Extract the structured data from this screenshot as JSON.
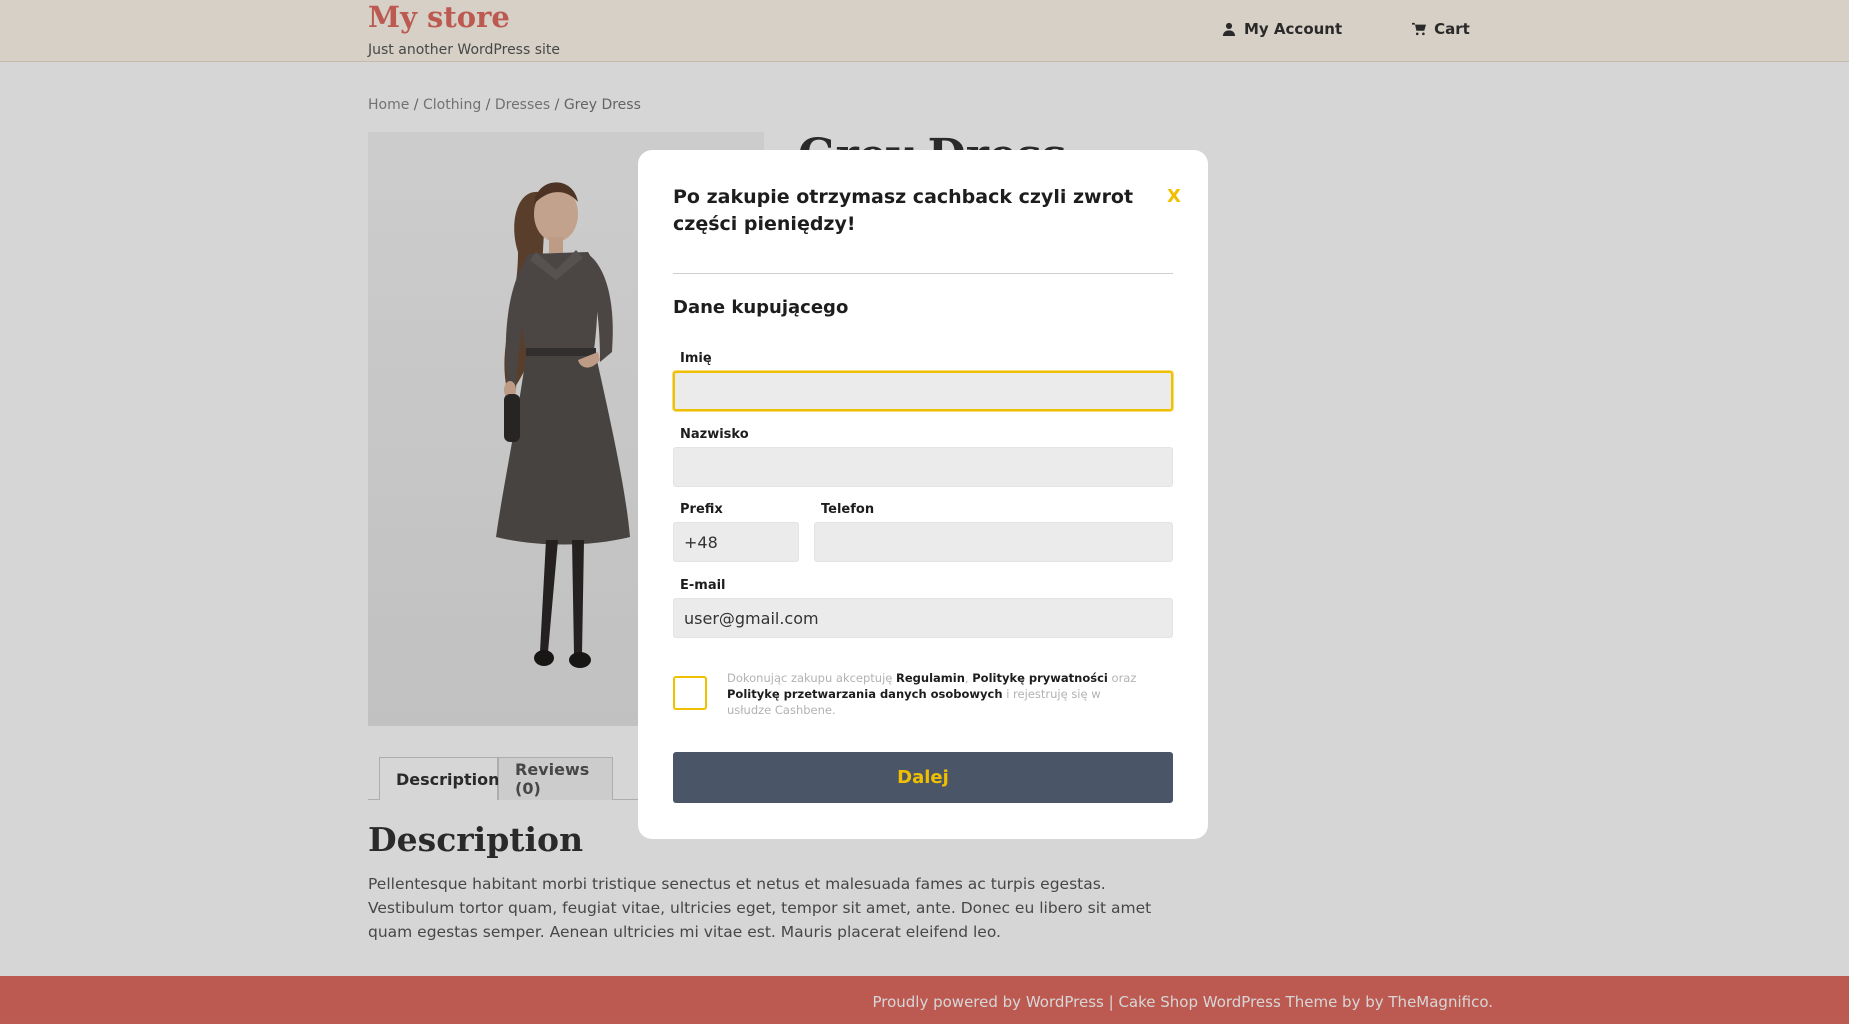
{
  "header": {
    "site_title": "My store",
    "tagline": "Just another WordPress site",
    "nav": [
      {
        "label": "My Account",
        "icon": "user-icon"
      },
      {
        "label": "Cart",
        "icon": "cart-icon"
      }
    ]
  },
  "breadcrumb": {
    "home": "Home",
    "sep1": " / ",
    "clothing": "Clothing",
    "sep2": " / ",
    "dresses": "Dresses",
    "sep3": " / ",
    "current": "Grey Dress"
  },
  "product": {
    "title": "Grey Dress"
  },
  "tabs": {
    "description": "Description",
    "reviews": "Reviews (0)"
  },
  "description": {
    "title": "Description",
    "text": "Pellentesque habitant morbi tristique senectus et netus et malesuada fames ac turpis egestas. Vestibulum tortor quam, feugiat vitae, ultricies eget, tempor sit amet, ante. Donec eu libero sit amet quam egestas semper. Aenean ultricies mi vitae est. Mauris placerat eleifend leo."
  },
  "footer": {
    "text": "Proudly powered by WordPress |  Cake Shop WordPress Theme by by TheMagnifico."
  },
  "modal": {
    "heading": "Po zakupie otrzymasz cachback czyli zwrot części pieniędzy!",
    "close": "X",
    "section_title": "Dane kupującego",
    "fields": {
      "first_name_label": "Imię",
      "first_name_value": "",
      "last_name_label": "Nazwisko",
      "last_name_value": "",
      "prefix_label": "Prefix",
      "prefix_value": "+48",
      "phone_label": "Telefon",
      "phone_value": "",
      "email_label": "E-mail",
      "email_value": "user@gmail.com"
    },
    "consent": {
      "t1": "Dokonując zakupu akceptuję ",
      "regulamin": "Regulamin",
      "comma": ", ",
      "privacy": "Politykę prywatności",
      "oraz": " oraz ",
      "data_policy": "Politykę przetwarzania danych osobowych",
      "t2": " i rejestruję się w usłudze Cashbene."
    },
    "submit": "Dalej"
  },
  "colors": {
    "accent": "#f0c000",
    "button_bg": "#4a5568",
    "brand": "#e06c61"
  }
}
